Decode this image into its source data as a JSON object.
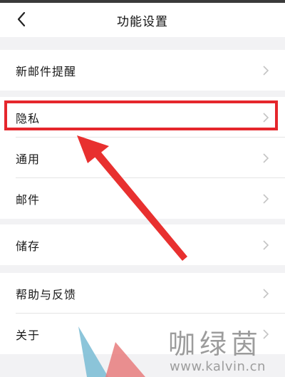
{
  "header": {
    "title": "功能设置"
  },
  "groups": [
    {
      "items": [
        {
          "label": "新邮件提醒"
        }
      ]
    },
    {
      "items": [
        {
          "label": "隐私"
        },
        {
          "label": "通用"
        },
        {
          "label": "邮件"
        }
      ]
    },
    {
      "items": [
        {
          "label": "储存"
        }
      ]
    },
    {
      "items": [
        {
          "label": "帮助与反馈"
        },
        {
          "label": "关于"
        }
      ]
    }
  ],
  "annotation": {
    "highlight_color": "#e5262c",
    "target": "隐私"
  },
  "watermark": {
    "brand": "咖绿茵",
    "url": "www.kalvin.cn"
  },
  "icons": {
    "back": "chevron-left-icon",
    "row": "chevron-right-icon"
  }
}
